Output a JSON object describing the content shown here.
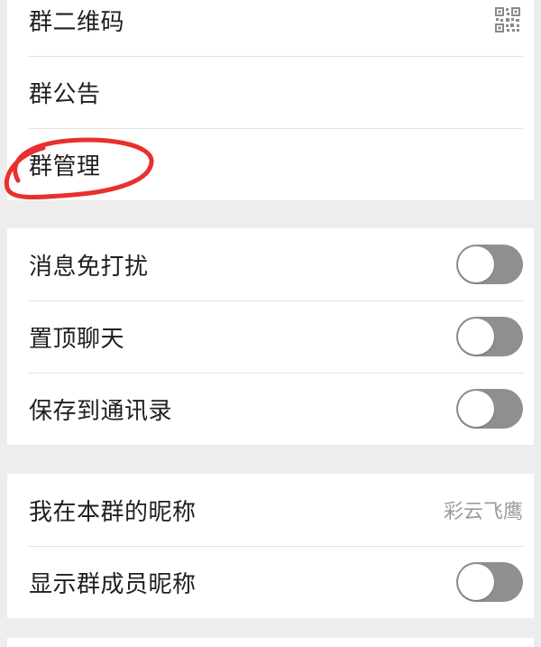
{
  "group_info": {
    "items": [
      {
        "label": "群二维码",
        "icon": "qr-code-icon"
      },
      {
        "label": "群公告"
      },
      {
        "label": "群管理"
      }
    ]
  },
  "chat_settings": {
    "items": [
      {
        "label": "消息免打扰",
        "toggle_on": false
      },
      {
        "label": "置顶聊天",
        "toggle_on": false
      },
      {
        "label": "保存到通讯录",
        "toggle_on": false
      }
    ]
  },
  "nickname_settings": {
    "my_nickname": {
      "label": "我在本群的昵称",
      "value": "彩云飞鹰"
    },
    "show_member_nicknames": {
      "label": "显示群成员昵称",
      "toggle_on": false
    }
  },
  "colors": {
    "background": "#ededed",
    "row_background": "#ffffff",
    "toggle_off": "#8f8f8f",
    "annotation": "#e8302f"
  }
}
